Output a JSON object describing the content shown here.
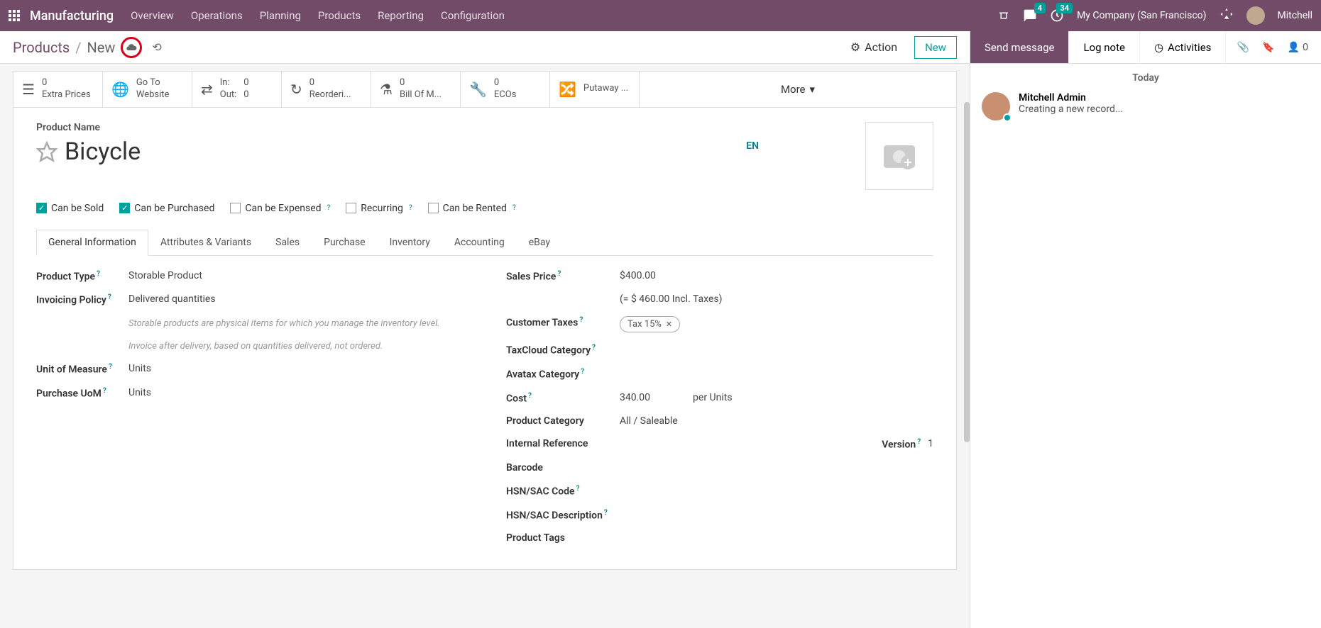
{
  "nav": {
    "brand": "Manufacturing",
    "menu": [
      "Overview",
      "Operations",
      "Planning",
      "Products",
      "Reporting",
      "Configuration"
    ],
    "chat_badge": "4",
    "clock_badge": "34",
    "company": "My Company (San Francisco)",
    "user": "Mitchell"
  },
  "breadcrumb": {
    "root": "Products",
    "current": "New",
    "action": "Action",
    "new_btn": "New"
  },
  "stats": {
    "extra_prices": {
      "count": "0",
      "label": "Extra Prices"
    },
    "website": {
      "line1": "Go To",
      "line2": "Website"
    },
    "inout": {
      "in_l": "In:",
      "in_v": "0",
      "out_l": "Out:",
      "out_v": "0"
    },
    "reorder": {
      "count": "0",
      "label": "Reorderi..."
    },
    "bom": {
      "count": "0",
      "label": "Bill Of M..."
    },
    "eco": {
      "count": "0",
      "label": "ECOs"
    },
    "putaway": "Putaway ...",
    "more": "More"
  },
  "product": {
    "label": "Product Name",
    "name": "Bicycle",
    "lang": "EN"
  },
  "checks": {
    "sold": "Can be Sold",
    "purchased": "Can be Purchased",
    "expensed": "Can be Expensed",
    "recurring": "Recurring",
    "rented": "Can be Rented"
  },
  "tabs": [
    "General Information",
    "Attributes & Variants",
    "Sales",
    "Purchase",
    "Inventory",
    "Accounting",
    "eBay"
  ],
  "fields": {
    "product_type": {
      "label": "Product Type",
      "value": "Storable Product"
    },
    "invoicing": {
      "label": "Invoicing Policy",
      "value": "Delivered quantities"
    },
    "help1": "Storable products are physical items for which you manage the inventory level.",
    "help2": "Invoice after delivery, based on quantities delivered, not ordered.",
    "uom": {
      "label": "Unit of Measure",
      "value": "Units"
    },
    "puom": {
      "label": "Purchase UoM",
      "value": "Units"
    },
    "sales_price": {
      "label": "Sales Price",
      "value": "$400.00",
      "incl": "(= $ 460.00 Incl. Taxes)"
    },
    "ctax": {
      "label": "Customer Taxes",
      "value": "Tax 15%"
    },
    "taxcloud": {
      "label": "TaxCloud Category"
    },
    "avatax": {
      "label": "Avatax Category"
    },
    "cost": {
      "label": "Cost",
      "value": "340.00",
      "per": "per Units"
    },
    "category": {
      "label": "Product Category",
      "value": "All / Saleable"
    },
    "intref": {
      "label": "Internal Reference",
      "ver_l": "Version",
      "ver_v": "1"
    },
    "barcode": {
      "label": "Barcode"
    },
    "hsn": {
      "label": "HSN/SAC Code"
    },
    "hsnd": {
      "label": "HSN/SAC Description"
    },
    "tags": {
      "label": "Product Tags"
    }
  },
  "chat": {
    "send": "Send message",
    "log": "Log note",
    "activities": "Activities",
    "followers": "0",
    "today": "Today",
    "msg_name": "Mitchell Admin",
    "msg_body": "Creating a new record..."
  }
}
